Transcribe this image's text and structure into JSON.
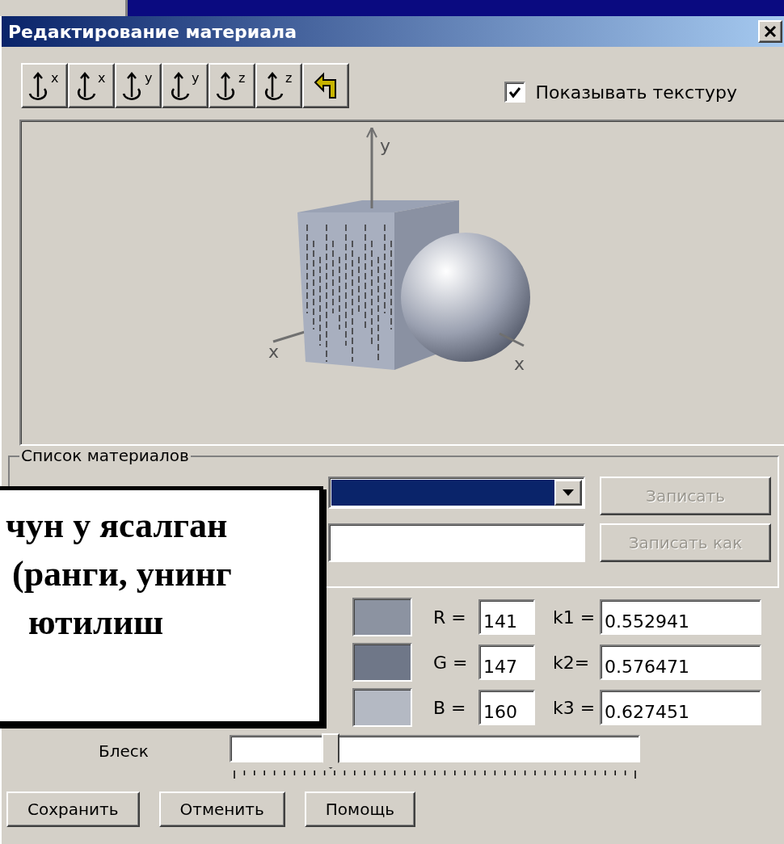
{
  "window": {
    "title": "Редактирование материала"
  },
  "toolbar": [
    {
      "kind": "rotate_cw",
      "axis": "x"
    },
    {
      "kind": "rotate_ccw",
      "axis": "x"
    },
    {
      "kind": "rotate_cw",
      "axis": "y"
    },
    {
      "kind": "rotate_ccw",
      "axis": "y"
    },
    {
      "kind": "rotate_cw",
      "axis": "z"
    },
    {
      "kind": "rotate_ccw",
      "axis": "z"
    },
    {
      "kind": "undo"
    }
  ],
  "show_texture": {
    "label": "Показывать текстуру",
    "checked": true
  },
  "preview": {
    "axis_labels": [
      "y",
      "x",
      "x"
    ]
  },
  "materials": {
    "legend": "Список материалов",
    "dropdown": {
      "selected": true
    },
    "write_button": {
      "label": "Записать",
      "disabled": true
    },
    "write_as_button": {
      "label": "Записать как",
      "disabled": true
    }
  },
  "channels": [
    {
      "color": "#8c93a1",
      "label": "R =",
      "value": "141",
      "k_label": "k1 =",
      "k_value": "0.552941"
    },
    {
      "color": "#6f7788",
      "label": "G =",
      "value": "147",
      "k_label": "k2=",
      "k_value": "0.576471"
    },
    {
      "color": "#b4b9c3",
      "label": "B =",
      "value": "160",
      "k_label": "k3 =",
      "k_value": "0.627451"
    }
  ],
  "shine": {
    "label": "Блеск",
    "level": 0.23
  },
  "buttons": [
    "Сохранить",
    "Отменить",
    "Помощь"
  ],
  "callout": {
    "lines": [
      "чун у ясалган",
      "(ранги, унинг",
      "ютилиш"
    ]
  }
}
